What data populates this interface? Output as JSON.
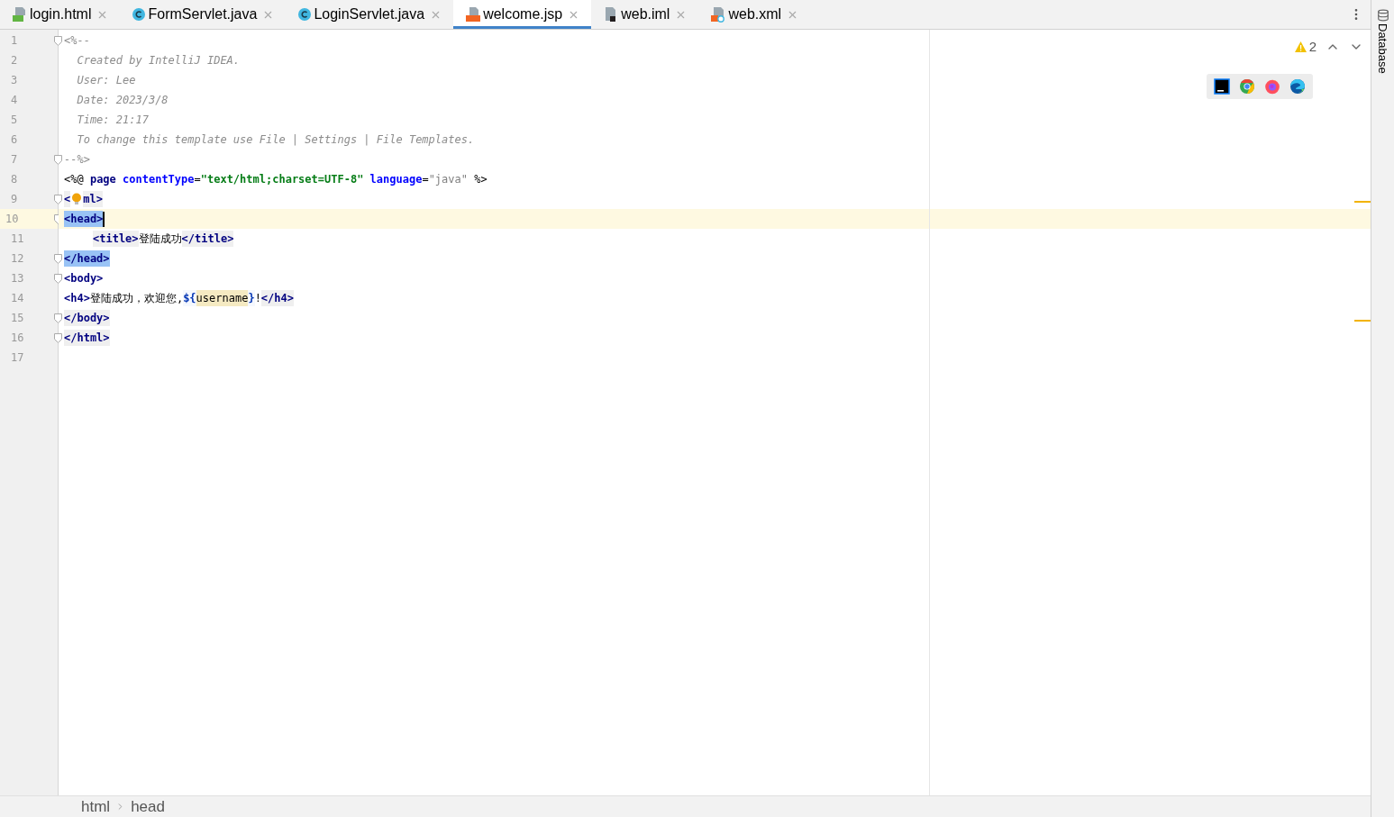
{
  "tabs": [
    {
      "label": "login.html",
      "kind": "html",
      "selected": false
    },
    {
      "label": "FormServlet.java",
      "kind": "class",
      "selected": false
    },
    {
      "label": "LoginServlet.java",
      "kind": "class",
      "selected": false
    },
    {
      "label": "welcome.jsp",
      "kind": "jsp",
      "selected": true
    },
    {
      "label": "web.iml",
      "kind": "iml",
      "selected": false
    },
    {
      "label": "web.xml",
      "kind": "xml",
      "selected": false
    }
  ],
  "editor": {
    "lines": [
      {
        "number": "1",
        "fold": true,
        "current": false,
        "tokens": [
          {
            "kind": "comment",
            "text": "<%--"
          }
        ]
      },
      {
        "number": "2",
        "fold": false,
        "current": false,
        "tokens": [
          {
            "kind": "comment",
            "text": "  Created by IntelliJ IDEA."
          }
        ]
      },
      {
        "number": "3",
        "fold": false,
        "current": false,
        "tokens": [
          {
            "kind": "comment",
            "text": "  User: Lee"
          }
        ]
      },
      {
        "number": "4",
        "fold": false,
        "current": false,
        "tokens": [
          {
            "kind": "comment",
            "text": "  Date: 2023/3/8"
          }
        ]
      },
      {
        "number": "5",
        "fold": false,
        "current": false,
        "tokens": [
          {
            "kind": "comment",
            "text": "  Time: 21:17"
          }
        ]
      },
      {
        "number": "6",
        "fold": false,
        "current": false,
        "tokens": [
          {
            "kind": "comment",
            "text": "  To change this template use File | Settings | File Templates."
          }
        ]
      },
      {
        "number": "7",
        "fold": true,
        "current": false,
        "tokens": [
          {
            "kind": "comment",
            "text": "--%>"
          }
        ]
      },
      {
        "number": "8",
        "fold": false,
        "current": false,
        "tokens": [
          {
            "kind": "punct",
            "text": "<%@ "
          },
          {
            "kind": "tag",
            "text": "page "
          },
          {
            "kind": "attr",
            "text": "contentType"
          },
          {
            "kind": "punct",
            "text": "="
          },
          {
            "kind": "string",
            "text": "\"text/html;charset=UTF-8\" "
          },
          {
            "kind": "attr",
            "text": "language"
          },
          {
            "kind": "punct",
            "text": "="
          },
          {
            "kind": "value",
            "text": "\"java\" "
          },
          {
            "kind": "punct",
            "text": "%>"
          }
        ]
      },
      {
        "number": "9",
        "fold": true,
        "current": false,
        "tokens": [
          {
            "kind": "tagbg",
            "text": "<"
          },
          {
            "kind": "bulb"
          },
          {
            "kind": "tagbg",
            "text": "ml>"
          }
        ]
      },
      {
        "number": "10",
        "fold": true,
        "current": true,
        "tokens": [
          {
            "kind": "match",
            "text": "<head>"
          },
          {
            "kind": "caret"
          }
        ]
      },
      {
        "number": "11",
        "fold": false,
        "current": false,
        "indented": true,
        "tokens": [
          {
            "kind": "tagbg",
            "text": "<title>"
          },
          {
            "kind": "text",
            "text": "登陆成功"
          },
          {
            "kind": "tagbg",
            "text": "</title>"
          }
        ]
      },
      {
        "number": "12",
        "fold": true,
        "current": false,
        "tokens": [
          {
            "kind": "match",
            "text": "</head>"
          }
        ]
      },
      {
        "number": "13",
        "fold": true,
        "current": false,
        "tokens": [
          {
            "kind": "tag",
            "text": "<body>"
          }
        ]
      },
      {
        "number": "14",
        "fold": false,
        "current": false,
        "tokens": [
          {
            "kind": "tag",
            "text": "<h4>"
          },
          {
            "kind": "text",
            "text": "登陆成功，欢迎您,"
          },
          {
            "kind": "el",
            "text": "${"
          },
          {
            "kind": "elvar",
            "text": "username"
          },
          {
            "kind": "el",
            "text": "}"
          },
          {
            "kind": "punct",
            "text": "!"
          },
          {
            "kind": "tagbg",
            "text": "</h4>"
          }
        ]
      },
      {
        "number": "15",
        "fold": true,
        "current": false,
        "tokens": [
          {
            "kind": "tagbg",
            "text": "</body>"
          }
        ]
      },
      {
        "number": "16",
        "fold": true,
        "current": false,
        "tokens": [
          {
            "kind": "tagbg",
            "text": "</html>"
          }
        ]
      },
      {
        "number": "17",
        "fold": false,
        "current": false
      }
    ]
  },
  "inspections": {
    "warnings": "2"
  },
  "browsers": [
    {
      "kind": "ide"
    },
    {
      "kind": "chrome"
    },
    {
      "kind": "firefox"
    },
    {
      "kind": "edge"
    }
  ],
  "side_panel": {
    "label": "Database"
  },
  "breadcrumbs": [
    "html",
    "head"
  ]
}
